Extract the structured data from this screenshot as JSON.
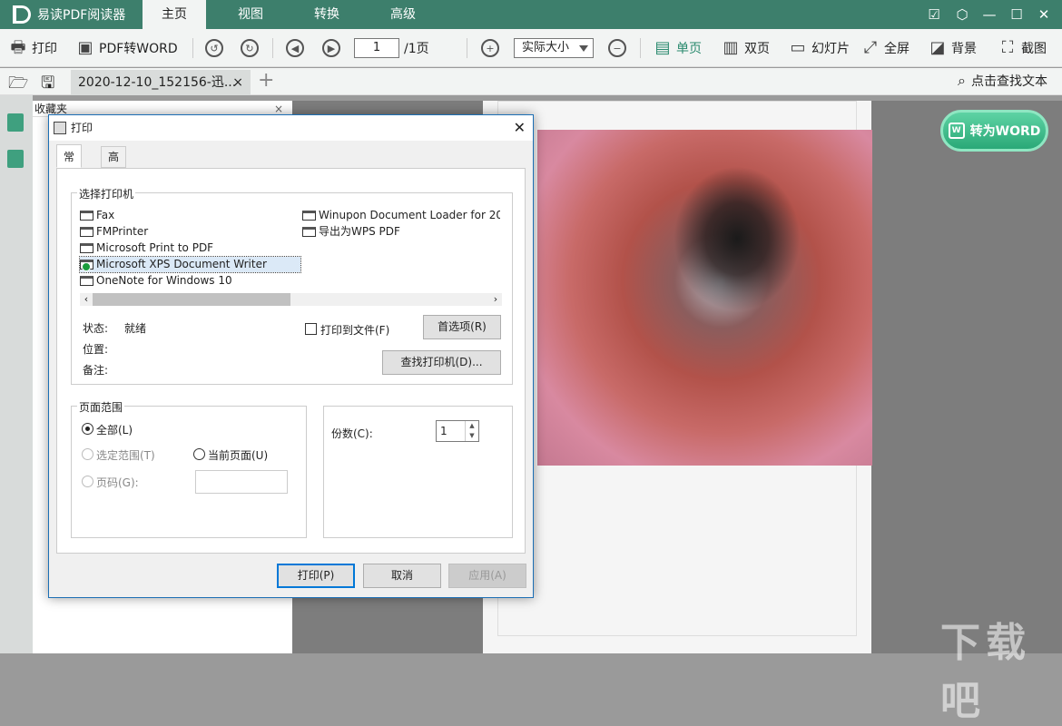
{
  "app": {
    "title": "易读PDF阅读器"
  },
  "menu": {
    "tabs": [
      "主页",
      "视图",
      "转换",
      "高级"
    ]
  },
  "toolbar": {
    "print": "打印",
    "pdf2word": "PDF转WORD",
    "page_current": "1",
    "page_total": "/1页",
    "zoom": "实际大小",
    "single": "单页",
    "double": "双页",
    "slideshow": "幻灯片",
    "fullscreen": "全屏",
    "background": "背景",
    "screenshot": "截图"
  },
  "tabbar": {
    "doc_tab": "2020-12-10_152156-迅...",
    "close": "×",
    "add": "+",
    "search": "点击查找文本"
  },
  "panel": {
    "title": "收藏夹",
    "close": "×"
  },
  "convert_button": "转为WORD",
  "dialog": {
    "title": "打印",
    "close": "✕",
    "tabs": [
      "常规",
      "高级"
    ],
    "printer_group": "选择打印机",
    "printers_left": [
      "Fax",
      "FMPrinter",
      "Microsoft Print to PDF",
      "Microsoft XPS Document Writer",
      "OneNote for Windows 10"
    ],
    "printers_right": [
      "Winupon Document Loader for 20",
      "导出为WPS PDF"
    ],
    "status_label": "状态:",
    "status_value": "就绪",
    "location_label": "位置:",
    "comment_label": "备注:",
    "print_to_file": "打印到文件(F)",
    "preferences": "首选项(R)",
    "find_printer": "查找打印机(D)...",
    "range_group": "页面范围",
    "range_all": "全部(L)",
    "range_selection": "选定范围(T)",
    "range_current": "当前页面(U)",
    "range_pages": "页码(G):",
    "copies_label": "份数(C):",
    "copies_value": "1",
    "btn_print": "打印(P)",
    "btn_cancel": "取消",
    "btn_apply": "应用(A)"
  },
  "watermark": "下载吧"
}
